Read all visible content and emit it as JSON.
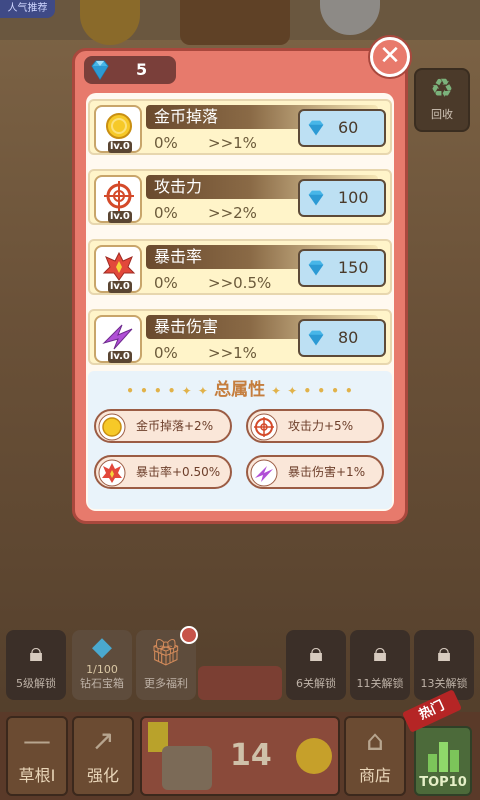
{
  "top_badge": "人气推荐",
  "recycle": {
    "label": "回收",
    "icon": "recycle-icon"
  },
  "gems": {
    "count": "5",
    "icon": "diamond-icon"
  },
  "upgrades": [
    {
      "title": "金币掉落",
      "level": "lv.0",
      "current": "0%",
      "next": ">>1%",
      "price": "60",
      "icon": "coin-icon"
    },
    {
      "title": "攻击力",
      "level": "lv.0",
      "current": "0%",
      "next": ">>2%",
      "price": "100",
      "icon": "target-icon"
    },
    {
      "title": "暴击率",
      "level": "lv.0",
      "current": "0%",
      "next": ">>0.5%",
      "price": "150",
      "icon": "crit-burst-icon"
    },
    {
      "title": "暴击伤害",
      "level": "lv.0",
      "current": "0%",
      "next": ">>1%",
      "price": "80",
      "icon": "crit-damage-icon"
    }
  ],
  "total": {
    "title": "总属性",
    "chips": [
      {
        "text": "金币掉落+2%",
        "icon": "coin-icon"
      },
      {
        "text": "攻击力+5%",
        "icon": "target-icon"
      },
      {
        "text": "暴击率+0.50%",
        "icon": "crit-burst-icon"
      },
      {
        "text": "暴击伤害+1%",
        "icon": "crit-damage-icon"
      }
    ]
  },
  "bottom": {
    "locks": [
      {
        "label": "5级解锁"
      },
      {
        "label": "6关解锁"
      },
      {
        "label": "11关解锁"
      },
      {
        "label": "13关解锁"
      }
    ],
    "diamond_box": {
      "count": "1/100",
      "label": "钻石宝箱"
    },
    "more_welfare": "更多福利",
    "grass": "草根I",
    "strengthen": "强化",
    "stage_number": "14",
    "shop": "商店",
    "hot": "热门",
    "top10": "TOP10"
  },
  "colors": {
    "modal_bg": "#e77a6c",
    "buy_button": "#bde0f3",
    "gold_text": "#c57e3e"
  }
}
